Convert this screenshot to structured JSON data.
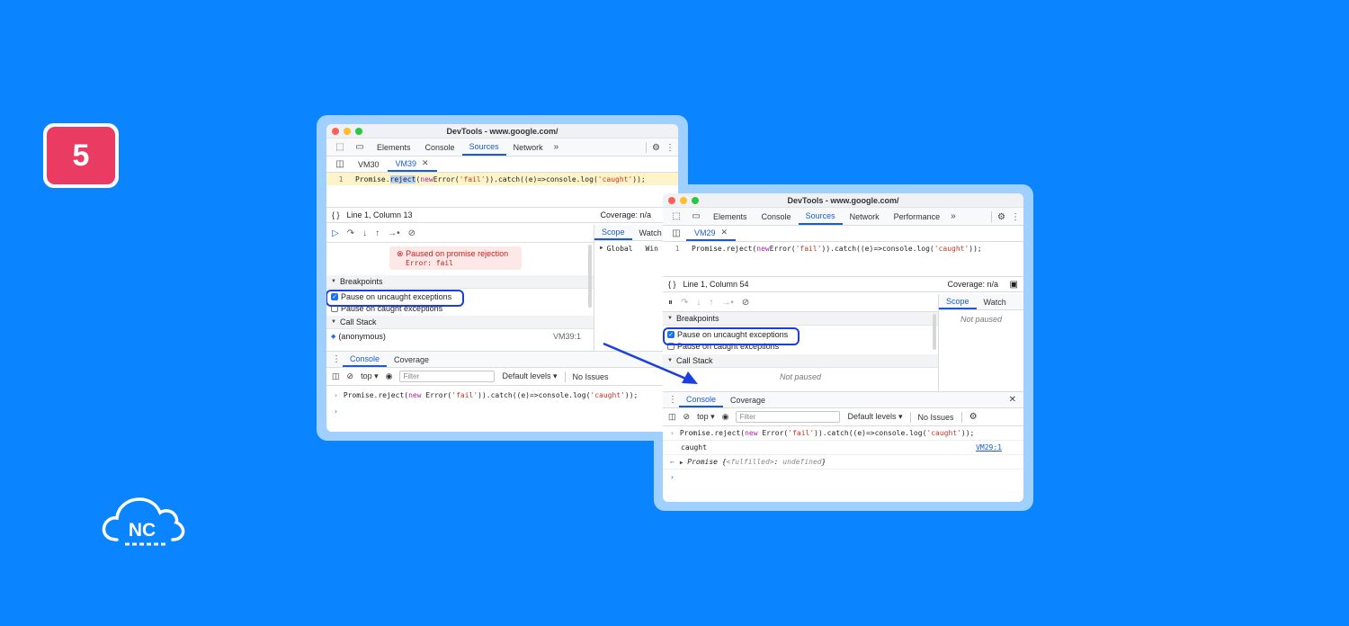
{
  "step_badge": "5",
  "logo": {
    "text": "NC"
  },
  "window1": {
    "title": "DevTools - www.google.com/",
    "tabs": [
      "Elements",
      "Console",
      "Sources",
      "Network"
    ],
    "active_tab": "Sources",
    "more": "»",
    "files": [
      {
        "label": "VM30"
      },
      {
        "label": "VM39",
        "active": true
      }
    ],
    "code": {
      "line_number": "1",
      "before": "Promise.",
      "selected": "reject",
      "open": "(",
      "kw": "new",
      "mid": " Error(",
      "str1": "'fail'",
      "mid2": ")).catch((e)=>console.log(",
      "str2": "'caught'",
      "end": "));"
    },
    "status": {
      "position": "Line 1, Column 13",
      "coverage": "Coverage: n/a"
    },
    "paused": {
      "title": "Paused on promise rejection",
      "error": "Error: fail"
    },
    "breakpoints_header": "Breakpoints",
    "uncaught_label": "Pause on uncaught exceptions",
    "caught_label": "Pause on caught exceptions",
    "callstack_header": "Call Stack",
    "callstack_item": {
      "name": "(anonymous)",
      "location": "VM39:1"
    },
    "scope_tabs": [
      "Scope",
      "Watch"
    ],
    "scope_item": {
      "name": "Global",
      "value": "Win"
    },
    "drawer_tabs": [
      "Console",
      "Coverage"
    ],
    "console_context": "top",
    "filter_placeholder": "Filter",
    "levels": "Default levels",
    "issues": "No Issues",
    "console_input": {
      "before": "Promise.reject(",
      "kw": "new",
      "mid": " Error(",
      "str1": "'fail'",
      "mid2": ")).catch((e)=>console.log(",
      "str2": "'caught'",
      "end": "));"
    }
  },
  "window2": {
    "title": "DevTools - www.google.com/",
    "tabs": [
      "Elements",
      "Console",
      "Sources",
      "Network",
      "Performance"
    ],
    "active_tab": "Sources",
    "more": "»",
    "files": [
      {
        "label": "VM29",
        "active": true
      }
    ],
    "code": {
      "line_number": "1",
      "before": "Promise.reject(",
      "kw": "new",
      "mid": " Error(",
      "str1": "'fail'",
      "mid2": ")).catch((e)=>console.log(",
      "str2": "'caught'",
      "end": "));"
    },
    "status": {
      "position": "Line 1, Column 54",
      "coverage": "Coverage: n/a"
    },
    "breakpoints_header": "Breakpoints",
    "uncaught_label": "Pause on uncaught exceptions",
    "caught_label": "Pause on caught exceptions",
    "callstack_header": "Call Stack",
    "callstack_status": "Not paused",
    "scope_tabs": [
      "Scope",
      "Watch"
    ],
    "scope_status": "Not paused",
    "drawer_tabs": [
      "Console",
      "Coverage"
    ],
    "console_context": "top",
    "filter_placeholder": "Filter",
    "levels": "Default levels",
    "issues": "No Issues",
    "console_input": {
      "before": "Promise.reject(",
      "kw": "new",
      "mid": " Error(",
      "str1": "'fail'",
      "mid2": ")).catch((e)=>console.log(",
      "str2": "'caught'",
      "end": "));"
    },
    "log_output": {
      "text": "caught",
      "source": "VM29:1"
    },
    "result": {
      "label": "Promise",
      "open": " {",
      "key": "<fulfilled>",
      "colon": ": ",
      "value": "undefined",
      "close": "}"
    }
  },
  "colors": {
    "background": "#0a84ff",
    "badge": "#ea3c63",
    "highlight": "#1a3fe0",
    "active_tab": "#1a5ccf"
  }
}
